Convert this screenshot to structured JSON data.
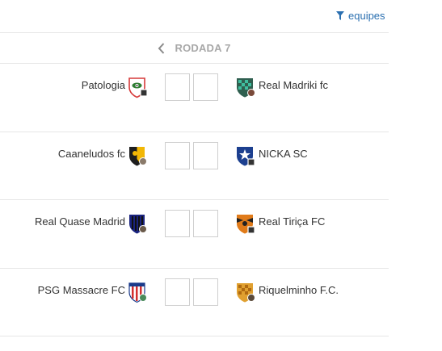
{
  "filter": {
    "label": "equipes",
    "icon": "filter-icon"
  },
  "round": {
    "title": "RODADA 7",
    "prev_icon": "chevron-left-icon"
  },
  "colors": {
    "accent": "#2a6fb0",
    "muted": "#a8a8a8",
    "divider": "#e6e6e6"
  },
  "matches": [
    {
      "home": "Patologia",
      "away": "Real Madriki fc",
      "home_score": "",
      "away_score": ""
    },
    {
      "home": "Caaneludos fc",
      "away": "NICKA SC",
      "home_score": "",
      "away_score": ""
    },
    {
      "home": "Real Quase Madrid",
      "away": "Real Tiriça FC",
      "home_score": "",
      "away_score": ""
    },
    {
      "home": "PSG Massacre FC",
      "away": "Riquelminho F.C.",
      "home_score": "",
      "away_score": ""
    }
  ]
}
